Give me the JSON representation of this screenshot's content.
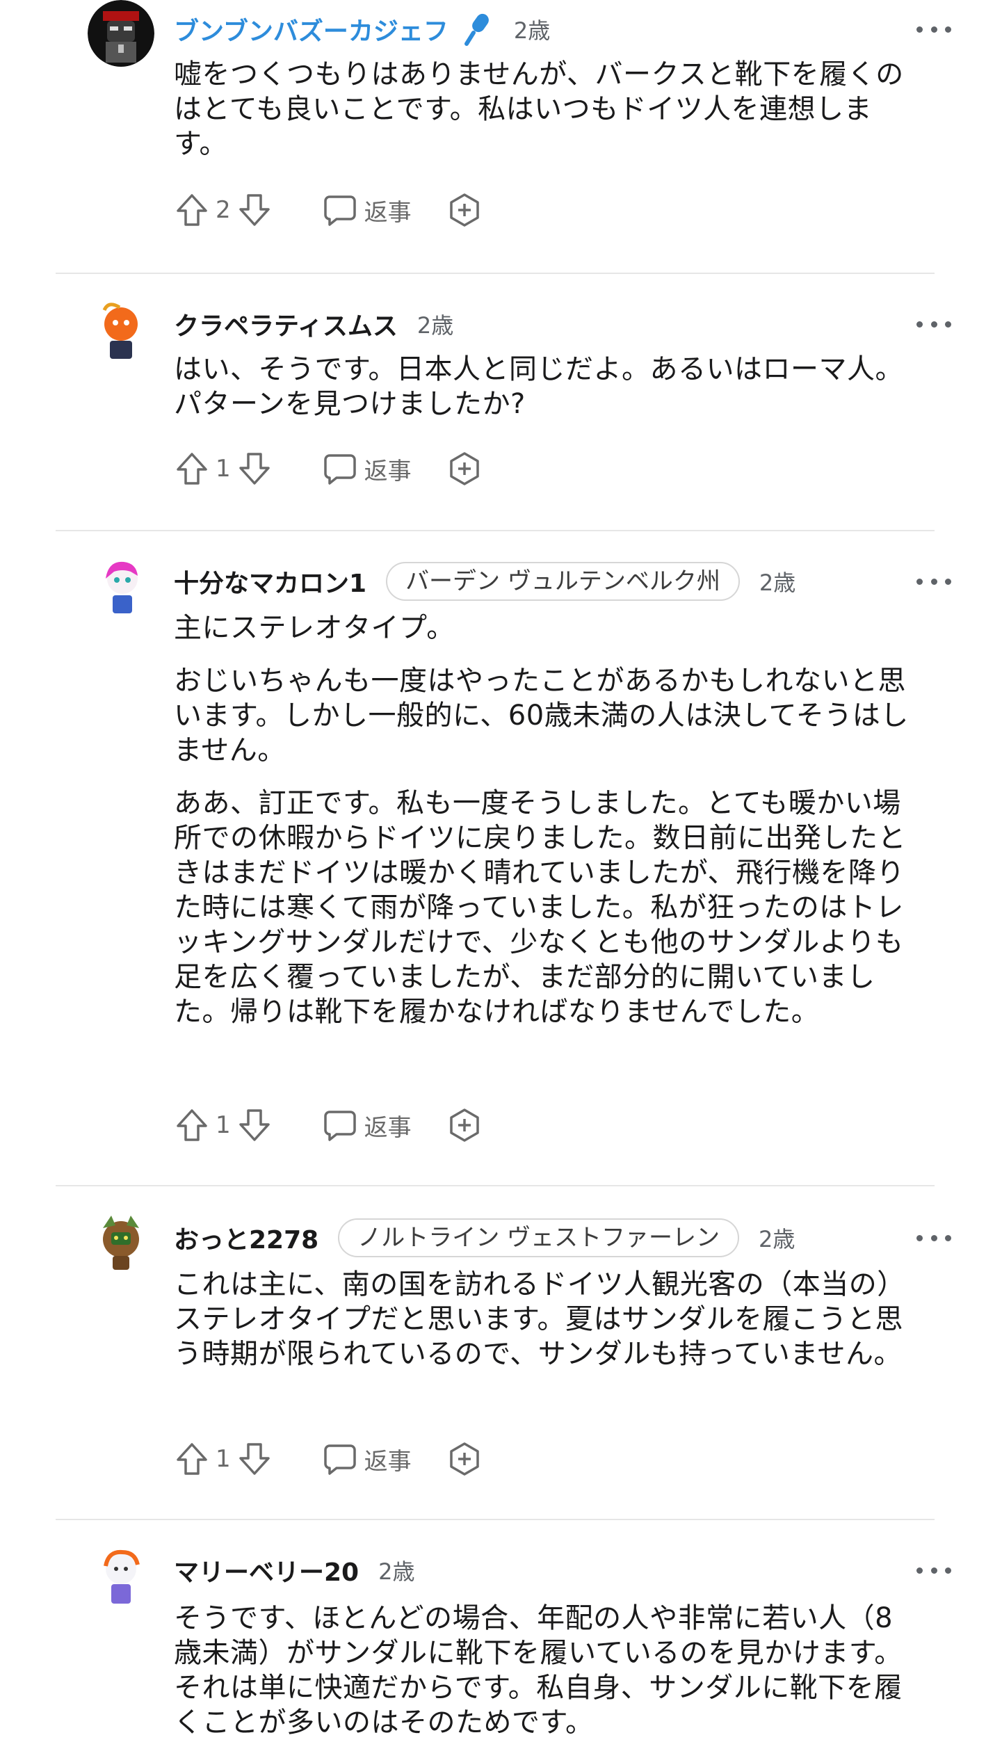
{
  "comments": [
    {
      "username": "ブンブンバズーカジェフ",
      "is_op": true,
      "flair": "",
      "age": "2歳",
      "paragraphs": [
        "嘘をつくつもりはありませんが、バークスと靴下を履くのはとても良いことです。私はいつもドイツ人を連想します。"
      ],
      "votes": "2",
      "reply_label": "返事"
    },
    {
      "username": "クラペラティスムス",
      "is_op": false,
      "flair": "",
      "age": "2歳",
      "paragraphs": [
        "はい、そうです。日本人と同じだよ。あるいはローマ人。パターンを見つけましたか?"
      ],
      "votes": "1",
      "reply_label": "返事"
    },
    {
      "username": "十分なマカロン1",
      "is_op": false,
      "flair": "バーデン ヴュルテンベルク州",
      "age": "2歳",
      "paragraphs": [
        "主にステレオタイプ。",
        "おじいちゃんも一度はやったことがあるかもしれないと思います。しかし一般的に、60歳未満の人は決してそうはしません。",
        "ああ、訂正です。私も一度そうしました。とても暖かい場所での休暇からドイツに戻りました。数日前に出発したときはまだドイツは暖かく晴れていましたが、飛行機を降りた時には寒くて雨が降っていました。私が狂ったのはトレッキングサンダルだけで、少なくとも他のサンダルよりも足を広く覆っていましたが、まだ部分的に開いていました。帰りは靴下を履かなければなりませんでした。"
      ],
      "votes": "1",
      "reply_label": "返事"
    },
    {
      "username": "おっと2278",
      "is_op": false,
      "flair": "ノルトライン ヴェストファーレン",
      "age": "2歳",
      "paragraphs": [
        "これは主に、南の国を訪れるドイツ人観光客の（本当の）ステレオタイプだと思います。夏はサンダルを履こうと思う時期が限られているので、サンダルも持っていません。"
      ],
      "votes": "1",
      "reply_label": "返事"
    },
    {
      "username": "マリーベリー20",
      "is_op": false,
      "flair": "",
      "age": "2歳",
      "paragraphs": [
        "そうです、ほとんどの場合、年配の人や非常に若い人（8 歳未満）がサンダルに靴下を履いているのを見かけます。それは単に快適だからです。私自身、サンダルに靴下を履くことが多いのはそのためです。"
      ],
      "votes": "",
      "reply_label": ""
    }
  ],
  "colors": {
    "op_username": "#2d8cdb",
    "icon_gray": "#6a6a6a",
    "divider": "#e6e6e6"
  },
  "icons": [
    "upvote-icon",
    "downvote-icon",
    "reply-icon",
    "award-icon",
    "more-options-icon",
    "microphone-icon"
  ]
}
